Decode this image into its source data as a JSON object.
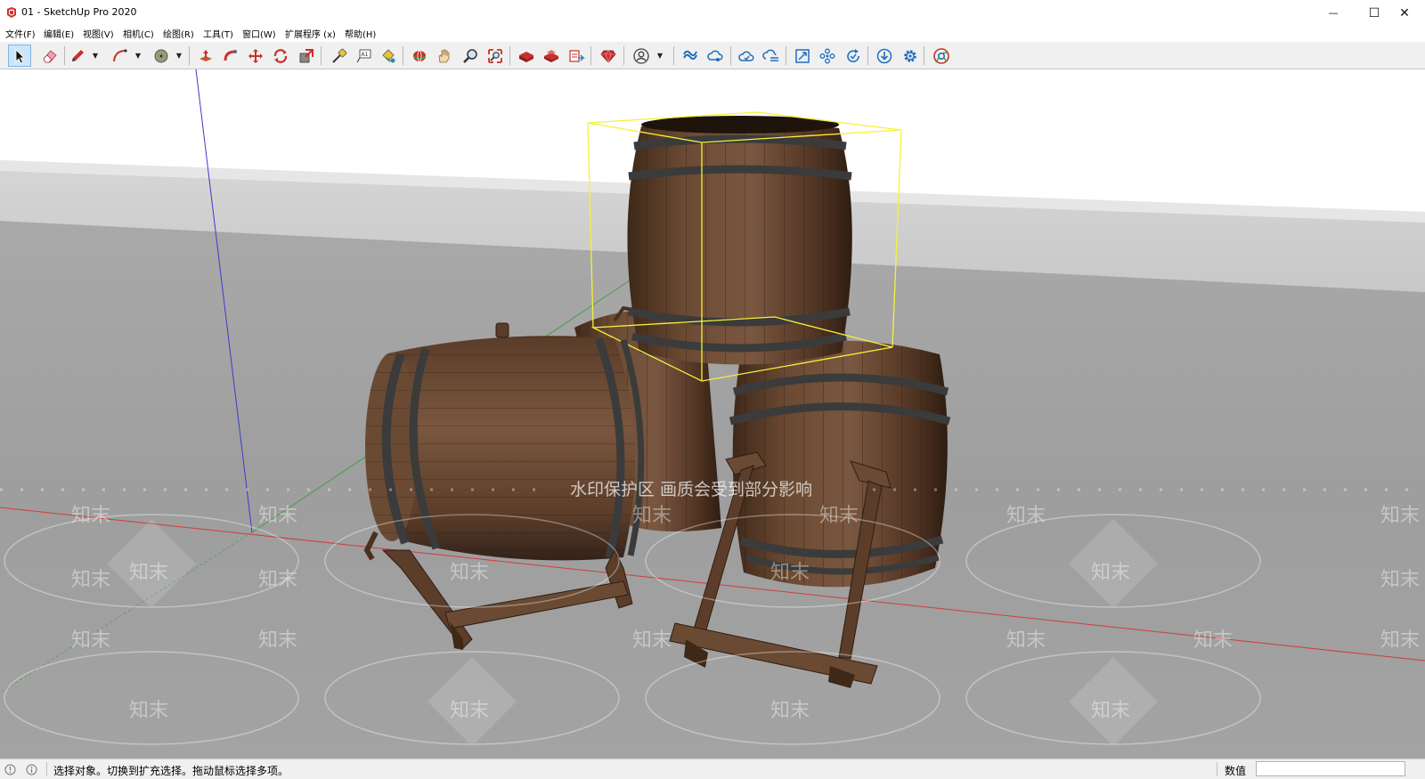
{
  "window": {
    "title": "01 - SketchUp Pro 2020",
    "minimize_glyph": "—",
    "maximize_glyph": "☐",
    "close_glyph": "✕"
  },
  "menu": [
    {
      "label": "文件(F)"
    },
    {
      "label": "编辑(E)"
    },
    {
      "label": "视图(V)"
    },
    {
      "label": "相机(C)"
    },
    {
      "label": "绘图(R)"
    },
    {
      "label": "工具(T)"
    },
    {
      "label": "窗口(W)"
    },
    {
      "label": "扩展程序 (x)"
    },
    {
      "label": "帮助(H)"
    }
  ],
  "toolbar": {
    "tools": [
      "select-icon",
      "eraser-icon",
      "pencil-icon",
      "arc-icon",
      "circle-icon",
      "push-pull-icon",
      "follow-me-icon",
      "move-icon",
      "rotate-icon",
      "scale-icon",
      "tape-measure-icon",
      "text-icon",
      "paint-bucket-icon",
      "orbit-icon",
      "pan-icon",
      "zoom-icon",
      "zoom-extents-icon",
      "3d-warehouse-icon",
      "extension-warehouse-icon",
      "layout-icon",
      "ruby-icon",
      "profile-icon",
      "trimble-connect-icon",
      "share-icon",
      "cloud-sync-icon",
      "cloud-upload-icon",
      "fit-view-icon",
      "components-icon",
      "refresh-icon",
      "download-icon",
      "settings-icon",
      "chrome-icon"
    ],
    "text_tool_label": "A1"
  },
  "viewport": {
    "watermark_banner": "水印保护区   画质会受到部分影响",
    "watermark_text": "知末",
    "selection_color": "#f5f23a",
    "axis_red": "#d23b3b",
    "axis_green": "#3fa13f",
    "axis_blue": "#3b3bd2"
  },
  "status": {
    "message": "选择对象。切换到扩充选择。拖动鼠标选择多项。",
    "vcb_label": "数值",
    "vcb_value": ""
  }
}
